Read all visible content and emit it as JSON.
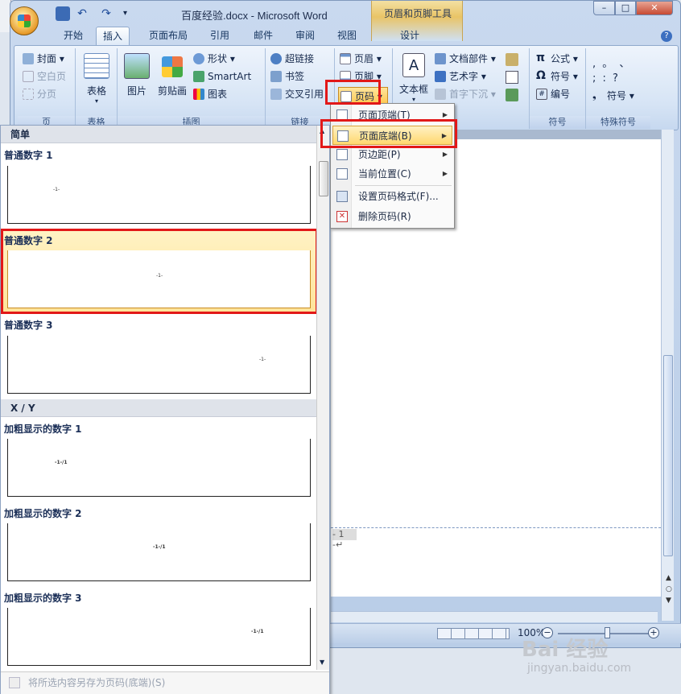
{
  "window": {
    "title": "百度经验.docx - Microsoft Word",
    "context_tab_group": "页眉和页脚工具",
    "qat": {
      "undo": "↶",
      "redo": "↷",
      "more": "▾"
    }
  },
  "tabs": [
    "开始",
    "插入",
    "页面布局",
    "引用",
    "邮件",
    "审阅",
    "视图",
    "设计"
  ],
  "ribbon": {
    "pages": {
      "cover": "封面",
      "blank": "空白页",
      "break": "分页",
      "label": "页"
    },
    "table": {
      "table": "表格",
      "label": "表格"
    },
    "illustrations": {
      "picture": "图片",
      "clipart": "剪贴画",
      "shapes": "形状",
      "smartart": "SmartArt",
      "chart": "图表",
      "label": "插图"
    },
    "links": {
      "hyperlink": "超链接",
      "bookmark": "书签",
      "crossref": "交叉引用",
      "label": "链接"
    },
    "header_footer": {
      "header": "页眉",
      "footer": "页脚",
      "page_number": "页码"
    },
    "text": {
      "textbox": "文本框",
      "quickparts": "文档部件",
      "wordart": "艺术字",
      "dropcap": "首字下沉"
    },
    "symbols": {
      "equation": "公式",
      "symbol": "符号",
      "numbering": "编号",
      "label": "符号"
    },
    "special": {
      "row1": ",  。  、",
      "row2": ";  :  ?",
      "symbol": "符号",
      "label": "特殊符号"
    }
  },
  "menu": {
    "items": [
      {
        "label": "页面顶端(T)",
        "submenu": true
      },
      {
        "label": "页面底端(B)",
        "submenu": true
      },
      {
        "label": "页边距(P)",
        "submenu": true
      },
      {
        "label": "当前位置(C)",
        "submenu": true
      },
      {
        "label": "设置页码格式(F)...",
        "submenu": false
      },
      {
        "label": "删除页码(R)",
        "submenu": false
      }
    ],
    "arrow": "▶"
  },
  "gallery": {
    "sections": [
      {
        "header": "简单"
      },
      {
        "header": "X / Y"
      }
    ],
    "items": [
      {
        "label": "普通数字 1",
        "preview": "-1-"
      },
      {
        "label": "普通数字 2",
        "preview": "-1-"
      },
      {
        "label": "普通数字 3",
        "preview": "-1-"
      },
      {
        "label": "加粗显示的数字 1",
        "preview": "-1-/1"
      },
      {
        "label": "加粗显示的数字 2",
        "preview": "-1-/1"
      },
      {
        "label": "加粗显示的数字 3",
        "preview": "-1-/1"
      }
    ],
    "footer": "将所选内容另存为页码(底端)(S)"
  },
  "document": {
    "page_marker": "- 1 -↵"
  },
  "status": {
    "zoom": "100%",
    "minus": "−",
    "plus": "+"
  },
  "watermark": {
    "brand": "Bai 经验",
    "url": "jingyan.baidu.com"
  },
  "colors": {
    "highlight": "#e21818",
    "accent": "#2b579a"
  }
}
